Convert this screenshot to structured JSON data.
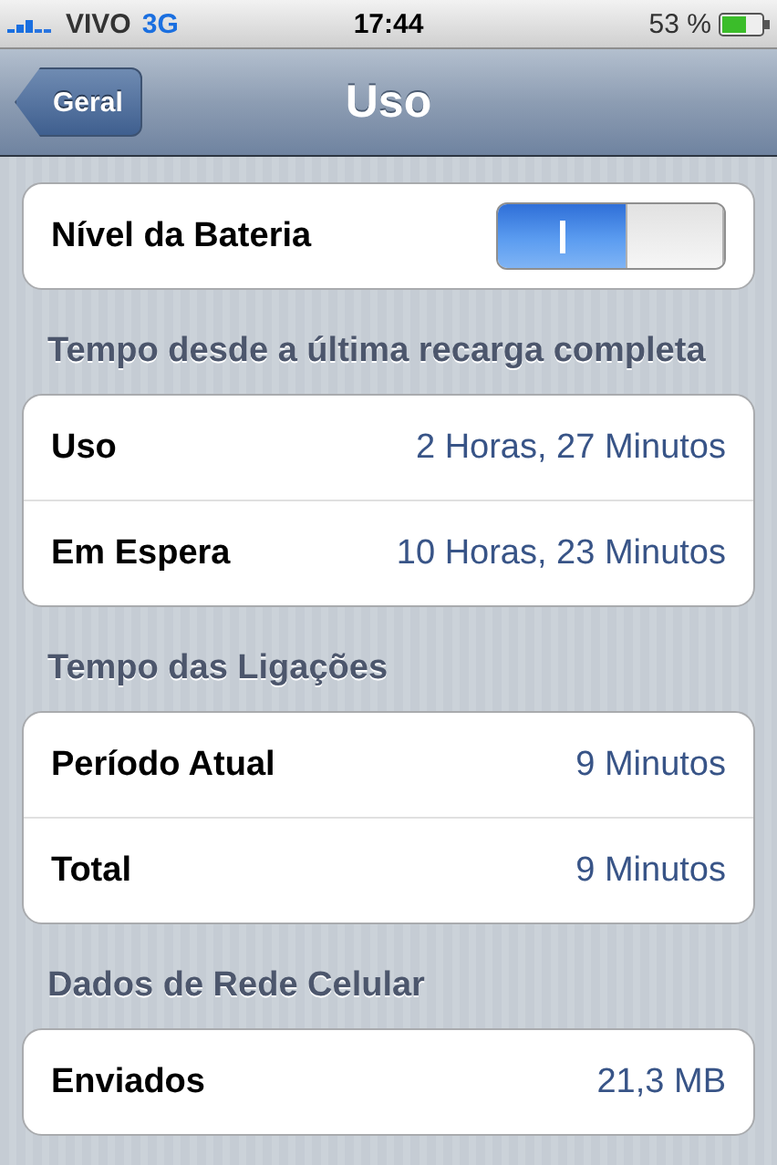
{
  "status_bar": {
    "carrier": "VIVO",
    "network": "3G",
    "time": "17:44",
    "battery": "53 %"
  },
  "nav_bar": {
    "back": "Geral",
    "title": "Uso"
  },
  "sections": [
    {
      "rows": [
        {
          "kind": "toggle",
          "label": "Nível da Bateria",
          "on": true
        }
      ]
    },
    {
      "header": "Tempo desde a última recarga completa",
      "rows": [
        {
          "kind": "value",
          "label": "Uso",
          "value": "2 Horas, 27 Minutos"
        },
        {
          "kind": "value",
          "label": "Em Espera",
          "value": "10 Horas, 23 Minutos"
        }
      ]
    },
    {
      "header": "Tempo das Ligações",
      "rows": [
        {
          "kind": "value",
          "label": "Período Atual",
          "value": "9 Minutos"
        },
        {
          "kind": "value",
          "label": "Total",
          "value": "9 Minutos"
        }
      ]
    },
    {
      "header": "Dados de Rede Celular",
      "rows": [
        {
          "kind": "value",
          "label": "Enviados",
          "value": "21,3 MB"
        }
      ]
    }
  ]
}
